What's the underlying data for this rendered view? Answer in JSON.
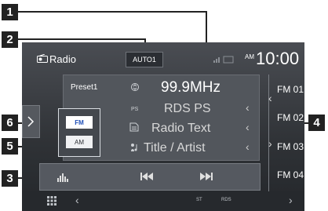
{
  "header": {
    "source_title": "Radio",
    "auto_mode": "AUTO1",
    "ampm": "AM",
    "clock": "10:00"
  },
  "info": {
    "preset_name": "Preset1",
    "frequency": "99.9MHz",
    "ps_label": "PS",
    "rds_ps": "RDS PS",
    "radio_text": "Radio Text",
    "title_artist": "Title / Artist"
  },
  "band": {
    "fm": "FM",
    "am": "AM"
  },
  "presets": [
    "FM 01",
    "FM 02",
    "FM 03",
    "FM 04"
  ],
  "bottom": {
    "st": "ST",
    "rds": "RDS"
  },
  "callouts": {
    "c1": "1",
    "c2": "2",
    "c3": "3",
    "c4": "4",
    "c5": "5",
    "c6": "6"
  },
  "colors": {
    "screen_bg": "#3c3f44",
    "panel_bg": "#52565c",
    "fm_active": "#1f4fb8",
    "callout_bg": "#222222"
  },
  "icons": {
    "radio": "radio-icon",
    "search": "search-updown-icon",
    "prev": "previous-track-icon",
    "next": "next-track-icon",
    "eq": "equalizer-icon",
    "menu": "grid-menu-icon",
    "status": "signal-status-icon",
    "tag": "radio-text-icon",
    "music": "title-artist-icon"
  }
}
